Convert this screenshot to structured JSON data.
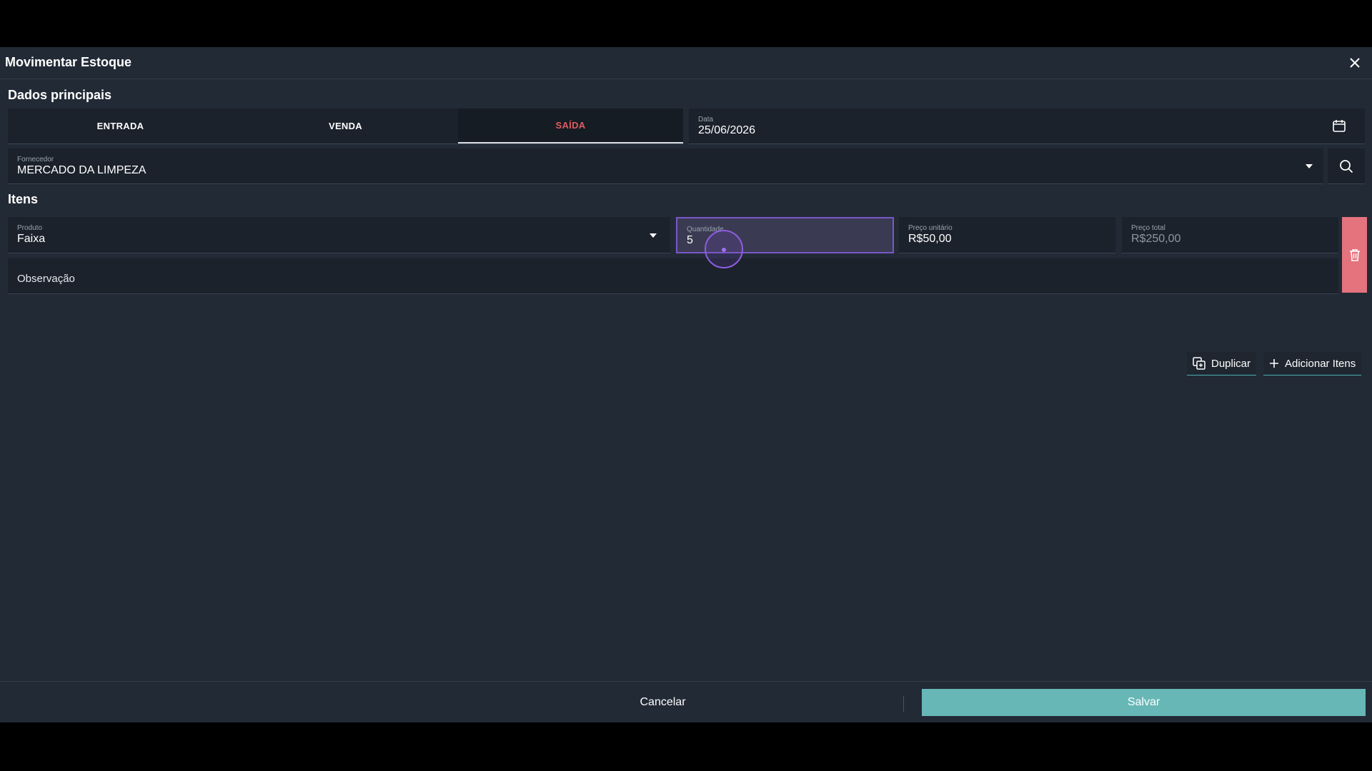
{
  "modal": {
    "title": "Movimentar Estoque",
    "close_icon": "close-icon"
  },
  "dados_principais": {
    "section_title": "Dados principais",
    "tabs": [
      {
        "label": "ENTRADA",
        "active": false
      },
      {
        "label": "VENDA",
        "active": false
      },
      {
        "label": "SAÍDA",
        "active": true
      }
    ],
    "data": {
      "label": "Data",
      "value": "25/06/2026",
      "icon": "calendar-icon"
    },
    "fornecedor": {
      "label": "Fornecedor",
      "value": "MERCADO DA LIMPEZA",
      "dropdown_icon": "chevron-down-icon",
      "search_icon": "search-icon"
    }
  },
  "itens": {
    "section_title": "Itens",
    "rows": [
      {
        "produto": {
          "label": "Produto",
          "value": "Faixa"
        },
        "quantidade": {
          "label": "Quantidade",
          "value": "5"
        },
        "preco_unitario": {
          "label": "Preço unitário",
          "value": "R$50,00"
        },
        "preco_total": {
          "label": "Preço total",
          "value": "R$250,00"
        },
        "observacao": {
          "placeholder": "Observação"
        },
        "delete_icon": "trash-icon"
      }
    ],
    "duplicar_label": "Duplicar",
    "adicionar_label": "Adicionar Itens"
  },
  "footer": {
    "cancel_label": "Cancelar",
    "save_label": "Salvar"
  },
  "colors": {
    "background": "#222a36",
    "field": "#1b222c",
    "active_tab": "#e05a5f",
    "save": "#68b7b7",
    "delete": "#e4737d",
    "focus": "#7a58c8"
  }
}
